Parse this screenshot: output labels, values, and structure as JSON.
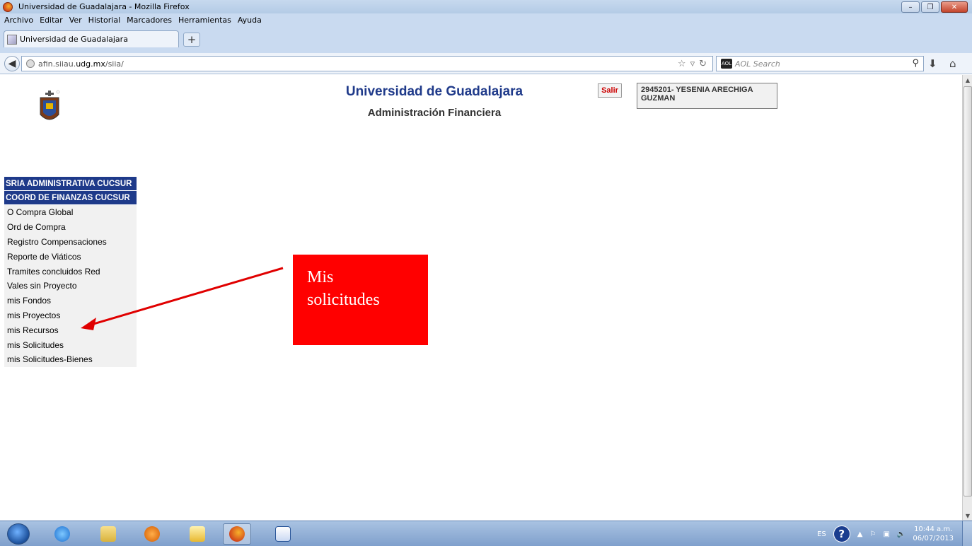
{
  "window": {
    "title": "Universidad de Guadalajara - Mozilla Firefox",
    "buttons": {
      "minimize": "–",
      "maximize": "❐",
      "close": "✕"
    }
  },
  "menubar": [
    "Archivo",
    "Editar",
    "Ver",
    "Historial",
    "Marcadores",
    "Herramientas",
    "Ayuda"
  ],
  "tabs": [
    {
      "label": "Universidad de Guadalajara"
    }
  ],
  "newtab_label": "+",
  "navbar": {
    "url_prefix": "afin.siiau.",
    "url_domain": "udg.mx",
    "url_suffix": "/siia/",
    "search_placeholder": "AOL Search",
    "search_engine_badge": "AOL"
  },
  "page": {
    "title": "Universidad de Guadalajara",
    "subtitle": "Administración Financiera",
    "logout_label": "Salir",
    "user_line1": "2945201- YESENIA ARECHIGA",
    "user_line2": "GUZMAN"
  },
  "menu": {
    "headers": [
      "SRIA ADMINISTRATIVA CUCSUR",
      "COORD DE FINANZAS CUCSUR"
    ],
    "items": [
      "O Compra Global",
      "Ord de Compra",
      "Registro Compensaciones",
      "Reporte de Viáticos",
      "Tramites concluidos Red",
      "Vales sin Proyecto",
      "mis Fondos",
      "mis Proyectos",
      "mis Recursos",
      "mis Solicitudes",
      "mis Solicitudes-Bienes"
    ]
  },
  "annotation": {
    "line1": "Mis",
    "line2": "solicitudes",
    "color": "#ff0000"
  },
  "taskbar": {
    "language": "ES",
    "help": "?",
    "time": "10:44 a.m.",
    "date": "06/07/2013"
  },
  "colors": {
    "menu_header": "#1e3a8a",
    "title": "#1f3a8a",
    "logout": "#cc0000"
  }
}
